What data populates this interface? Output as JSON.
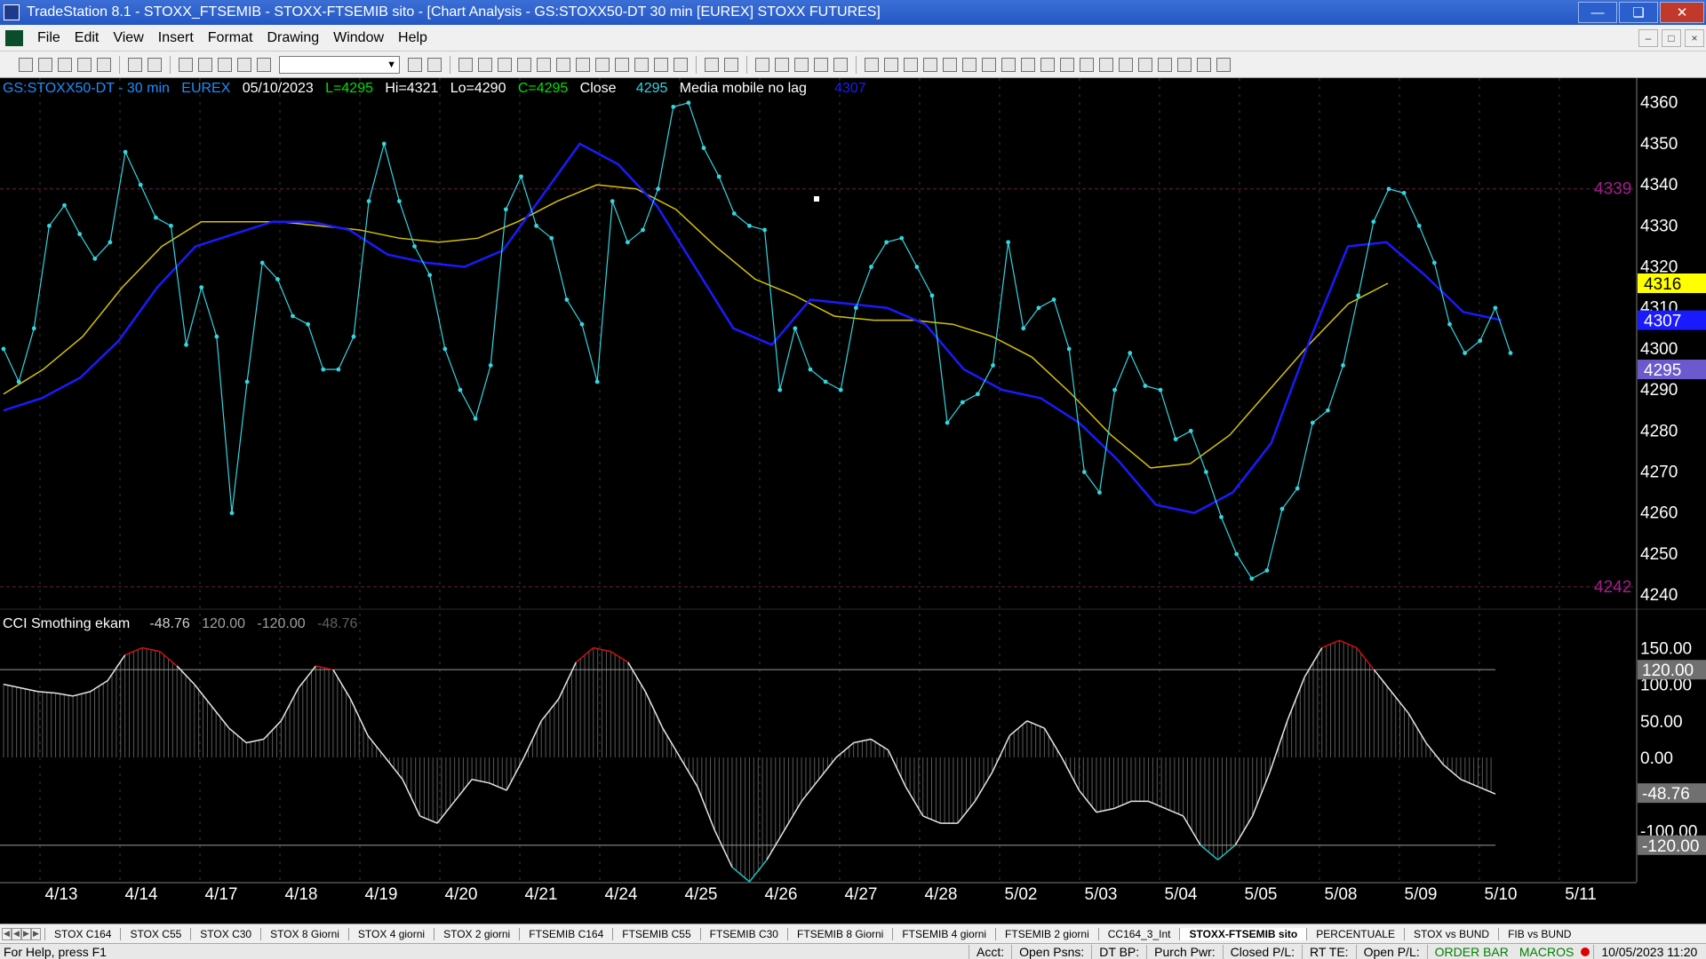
{
  "window": {
    "title": "TradeStation 8.1 - STOXX_FTSEMIB - STOXX-FTSEMIB sito - [Chart Analysis - GS:STOXX50-DT  30 min  [EUREX] STOXX FUTURES]",
    "minimize": "—",
    "maximize": "❏",
    "close": "✕"
  },
  "menu": {
    "items": [
      "File",
      "Edit",
      "View",
      "Insert",
      "Format",
      "Drawing",
      "Window",
      "Help"
    ],
    "mdi_min": "–",
    "mdi_restore": "□",
    "mdi_close": "×"
  },
  "toolbar": {
    "symbol_combo_arrow": "▼",
    "icons": [
      "new-icon",
      "open-icon",
      "save-icon",
      "print-icon",
      "grid-icon",
      "lock-icon",
      "chart-icon",
      "hand-icon",
      "zoom-in-icon",
      "zoom-out-icon",
      "pointer-icon",
      "crosshair-icon",
      "trendline-icon",
      "text-icon"
    ]
  },
  "header": {
    "symbol": "GS:STOXX50-DT - 30 min",
    "exchange": "EUREX",
    "date": "05/10/2023",
    "low_label": "L=4295",
    "high_label": "Hi=4321",
    "lo_label": "Lo=4290",
    "close_label": "C=4295",
    "close_word": "Close",
    "close_value": "4295",
    "indicator_name": "Media mobile no lag",
    "indicator_value": "4307"
  },
  "cci_header": {
    "name": "CCI Smothing ekam",
    "values": [
      "-48.76",
      "120.00",
      "-120.00",
      "-48.76"
    ]
  },
  "colors": {
    "price": "#33d6e0",
    "ma_blue": "#1a1aff",
    "ma_yellow": "#d6c400",
    "level_line": "#6a1a4a",
    "level_text": "#a0208a",
    "cci_line": "#e6e6e6",
    "cci_over": "#d01010",
    "cci_under": "#20c0c0",
    "axis_text": "#ffffff",
    "marker_yellow": "#ffff00",
    "marker_blue": "#1a1aff",
    "marker_purple": "#6a5acd",
    "marker_gray": "#707070"
  },
  "price_axis": {
    "ticks": [
      "4360",
      "4350",
      "4340",
      "4330",
      "4320",
      "4310",
      "4300",
      "4290",
      "4280",
      "4270",
      "4260",
      "4250",
      "4240"
    ],
    "tick_values": [
      4360,
      4350,
      4340,
      4330,
      4320,
      4310,
      4300,
      4290,
      4280,
      4270,
      4260,
      4250,
      4240
    ],
    "markers": [
      {
        "label": "4316",
        "value": 4316,
        "color": "yellow"
      },
      {
        "label": "4307",
        "value": 4307,
        "color": "blue"
      },
      {
        "label": "4295",
        "value": 4295,
        "color": "purple"
      }
    ],
    "levels": [
      {
        "label": "4339",
        "value": 4339
      },
      {
        "label": "4242",
        "value": 4242
      }
    ]
  },
  "cci_axis": {
    "ticks": [
      "150.00",
      "100.00",
      "50.00",
      "0.00",
      "-100.00"
    ],
    "tick_values": [
      150,
      100,
      50,
      0,
      -100
    ],
    "markers": [
      {
        "label": "120.00",
        "value": 120
      },
      {
        "label": "-48.76",
        "value": -48.76
      },
      {
        "label": "-120.00",
        "value": -120
      }
    ]
  },
  "date_axis": {
    "labels": [
      "4/13",
      "4/14",
      "4/17",
      "4/18",
      "4/19",
      "4/20",
      "4/21",
      "4/24",
      "4/25",
      "4/26",
      "4/27",
      "4/28",
      "5/02",
      "5/03",
      "5/04",
      "5/05",
      "5/08",
      "5/09",
      "5/10",
      "5/11"
    ]
  },
  "chart_data": {
    "type": "line",
    "symbol": "GS:STOXX50-DT",
    "interval": "30 min",
    "ylim": [
      4237,
      4366
    ],
    "x": [
      "4/12",
      "4/13",
      "4/14",
      "4/17",
      "4/18",
      "4/19",
      "4/20",
      "4/21",
      "4/24",
      "4/25",
      "4/26",
      "4/27",
      "4/28",
      "5/02",
      "5/03",
      "5/04",
      "5/05",
      "5/08",
      "5/09",
      "5/10"
    ],
    "series": [
      {
        "values": [
          4300,
          4292,
          4305,
          4330,
          4335,
          4328,
          4322,
          4326,
          4348,
          4340,
          4332,
          4330,
          4301,
          4315,
          4303,
          4260,
          4292,
          4321,
          4317,
          4308,
          4306,
          4295,
          4295,
          4303,
          4336,
          4350,
          4336,
          4325,
          4318,
          4300,
          4290,
          4283,
          4296,
          4334,
          4342,
          4330,
          4327,
          4312,
          4306,
          4292,
          4336,
          4326,
          4329,
          4339,
          4359,
          4360,
          4349,
          4342,
          4333,
          4330,
          4329,
          4290,
          4305,
          4295,
          4292,
          4290,
          4310,
          4320,
          4326,
          4327,
          4320,
          4313,
          4282,
          4287,
          4289,
          4296,
          4326,
          4305,
          4310,
          4312,
          4300,
          4270,
          4265,
          4290,
          4299,
          4291,
          4290,
          4278,
          4280,
          4270,
          4259,
          4250,
          4244,
          4246,
          4261,
          4266,
          4282,
          4285,
          4296,
          4313,
          4331,
          4339,
          4338,
          4330,
          4321,
          4306,
          4299,
          4302,
          4310,
          4299
        ]
      },
      {
        "name": "Media mobile no lag",
        "values": [
          4285,
          4288,
          4293,
          4302,
          4315,
          4325,
          4328,
          4331,
          4331,
          4329,
          4323,
          4321,
          4320,
          4324,
          4337,
          4350,
          4345,
          4335,
          4320,
          4305,
          4301,
          4312,
          4311,
          4310,
          4306,
          4295,
          4290,
          4288,
          4282,
          4273,
          4262,
          4260,
          4265,
          4277,
          4302,
          4325,
          4326,
          4318,
          4309,
          4307
        ]
      },
      {
        "values": [
          4289,
          4295,
          4303,
          4315,
          4325,
          4331,
          4331,
          4331,
          4330,
          4329,
          4327,
          4326,
          4327,
          4331,
          4336,
          4340,
          4339,
          4334,
          4325,
          4317,
          4313,
          4308,
          4307,
          4307,
          4306,
          4303,
          4298,
          4289,
          4279,
          4271,
          4272,
          4279,
          4290,
          4301,
          4311,
          4316
        ]
      }
    ]
  },
  "cci_data": {
    "type": "area",
    "ylim": [
      -170,
      170
    ],
    "values": [
      100,
      95,
      90,
      88,
      84,
      90,
      105,
      140,
      150,
      145,
      125,
      100,
      70,
      40,
      20,
      25,
      50,
      95,
      125,
      120,
      80,
      30,
      0,
      -30,
      -80,
      -90,
      -60,
      -30,
      -35,
      -45,
      0,
      50,
      80,
      130,
      150,
      145,
      130,
      90,
      40,
      0,
      -40,
      -100,
      -150,
      -170,
      -140,
      -100,
      -60,
      -30,
      0,
      20,
      25,
      10,
      -40,
      -80,
      -90,
      -90,
      -60,
      -20,
      30,
      50,
      40,
      0,
      -45,
      -75,
      -70,
      -60,
      -60,
      -70,
      -80,
      -120,
      -140,
      -120,
      -80,
      -20,
      50,
      110,
      150,
      160,
      150,
      120,
      90,
      60,
      20,
      -10,
      -30,
      -40,
      -50
    ]
  },
  "tabs": {
    "items": [
      "STOX C164",
      "STOX C55",
      "STOX  C30",
      "STOX  8 Giorni",
      "STOX 4 giorni",
      "STOX  2 giorni",
      "FTSEMIB C164",
      "FTSEMIB C55",
      "FTSEMIB C30",
      "FTSEMIB  8 Giorni",
      "FTSEMIB  4 giorni",
      "FTSEMIB  2 giorni",
      "CC164_3_Int",
      "STOXX-FTSEMIB sito",
      "PERCENTUALE",
      "STOX vs BUND",
      "FIB vs BUND"
    ],
    "active": "STOXX-FTSEMIB sito"
  },
  "status": {
    "help": "For Help, press F1",
    "acct": "Acct:",
    "open_psns": "Open Psns:",
    "dt_bp": "DT BP:",
    "purch_pwr": "Purch Pwr:",
    "closed_pl": "Closed P/L:",
    "rt_te": "RT TE:",
    "open_pl": "Open P/L:",
    "order_bar": "ORDER BAR",
    "macros": "MACROS",
    "datetime": "10/05/2023 11:20"
  }
}
